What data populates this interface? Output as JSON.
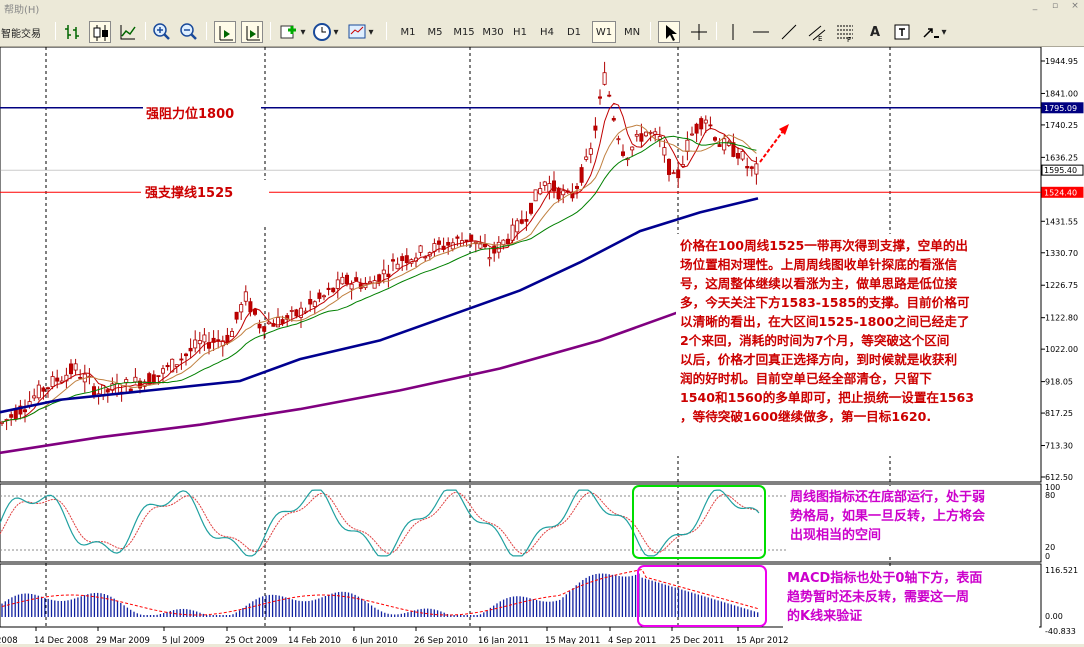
{
  "menu": {
    "help": "帮助(H)"
  },
  "window_controls": [
    "_",
    "▫",
    "×"
  ],
  "toolbar": {
    "trade_label": "智能交易",
    "timeframes": [
      "M1",
      "M5",
      "M15",
      "M30",
      "H1",
      "H4",
      "D1",
      "W1",
      "MN"
    ],
    "active_timeframe": "W1",
    "text_tool": "A"
  },
  "chart": {
    "price_axis": [
      "1944.95",
      "1841.00",
      "1740.25",
      "1636.25",
      "1431.55",
      "1330.70",
      "1226.75",
      "1122.80",
      "1022.00",
      "918.05",
      "817.25",
      "713.30",
      "612.50"
    ],
    "price_tags": {
      "resistance": "1795.09",
      "current": "1595.40",
      "support": "1524.40"
    },
    "stoch_axis": [
      "100",
      "80",
      "20",
      "0"
    ],
    "macd_axis": [
      "116.521",
      "0.00",
      "-40.833"
    ],
    "date_axis": [
      "2008",
      "14 Dec 2008",
      "29 Mar 2009",
      "5 Jul 2009",
      "25 Oct 2009",
      "14 Feb 2010",
      "6 Jun 2010",
      "26 Sep 2010",
      "16 Jan 2011",
      "15 May 2011",
      "4 Sep 2011",
      "25 Dec 2011",
      "15 Apr 2012"
    ]
  },
  "annotations": {
    "resistance_label": "强阻力位1800",
    "support_label": "强支撑线1525",
    "main_note": [
      "价格在100周线1525一带再次得到支撑，空单的出",
      "场位置相对理性。上周周线图收单针探底的看涨信",
      "号，这周整体继续以看涨为主，做单思路是低位接",
      "多，今天关注下方1583-1585的支撑。目前价格可",
      "以清晰的看出，在大区间1525-1800之间已经走了",
      "2个来回，消耗的时间为7个月，等突破这个区间",
      "以后，价格才回真正选择方向，到时候就是收获利",
      "润的好时机。目前空单已经全部清仓，只留下",
      "1540和1560的多单即可，把止损统一设置在1563",
      "，等待突破1600继续做多，第一目标1620."
    ],
    "stoch_note": [
      "周线图指标还在底部运行，处于弱",
      "势格局，如果一旦反转，上方将会",
      "出现相当的空间"
    ],
    "macd_note": [
      "MACD指标也处于0轴下方，表面",
      "趋势暂时还未反转，需要这一周",
      "的K线来验证"
    ]
  },
  "colors": {
    "resistance_line": "#000080",
    "support_line": "#ff0000",
    "ma_fast": "#c00000",
    "ma_mid": "#c08040",
    "ma_slow": "#008000",
    "ma100": "#000090",
    "ma200": "#800080",
    "stoch_main": "#20a0a0",
    "stoch_signal": "#e04040",
    "macd_hist": "#1020a0",
    "macd_signal": "#ff0000",
    "note_red": "#cc0000",
    "note_magenta": "#cc00cc",
    "box_green": "#00dd00",
    "box_magenta": "#ee00ee"
  }
}
